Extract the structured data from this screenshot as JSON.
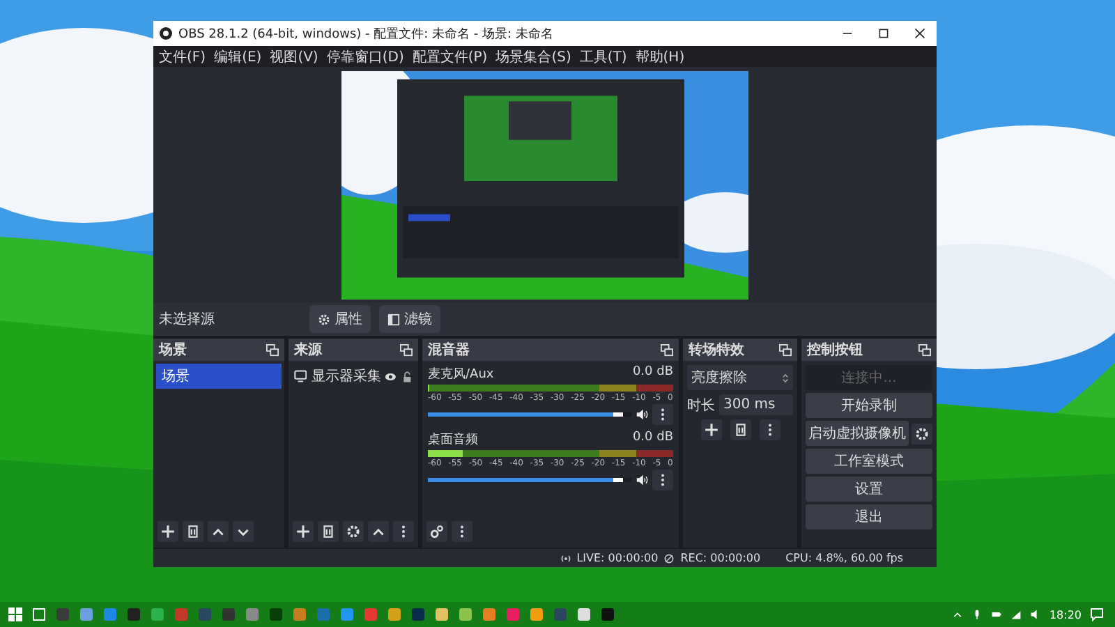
{
  "window": {
    "title": "OBS 28.1.2 (64-bit, windows) - 配置文件: 未命名 - 场景: 未命名"
  },
  "menu": [
    "文件(F)",
    "编辑(E)",
    "视图(V)",
    "停靠窗口(D)",
    "配置文件(P)",
    "场景集合(S)",
    "工具(T)",
    "帮助(H)"
  ],
  "context_bar": {
    "label": "未选择源",
    "buttons": [
      {
        "label": "属性",
        "kind": "gear"
      },
      {
        "label": "滤镜",
        "kind": "filter"
      }
    ]
  },
  "scenes": {
    "title": "场景",
    "items": [
      {
        "label": "场景",
        "selected": true
      }
    ]
  },
  "sources": {
    "title": "来源",
    "items": [
      {
        "label": "显示器采集",
        "visible": true,
        "locked": false
      }
    ]
  },
  "mixer": {
    "title": "混音器",
    "channels": [
      {
        "name": "麦克风/Aux",
        "reading": "0.0 dB",
        "meter": {
          "level": 0
        },
        "ticks": [
          "-60",
          "-55",
          "-50",
          "-45",
          "-40",
          "-35",
          "-30",
          "-25",
          "-20",
          "-15",
          "-10",
          "-5",
          "0"
        ],
        "volume": {
          "level": 0.96
        },
        "muted": false
      },
      {
        "name": "桌面音频",
        "reading": "0.0 dB",
        "meter": {
          "level": 0.14
        },
        "ticks": [
          "-60",
          "-55",
          "-50",
          "-45",
          "-40",
          "-35",
          "-30",
          "-25",
          "-20",
          "-15",
          "-10",
          "-5",
          "0"
        ],
        "volume": {
          "level": 0.96
        },
        "muted": false
      }
    ]
  },
  "transitions": {
    "title": "转场特效",
    "selected": "亮度擦除",
    "duration_label": "时长",
    "duration": "300 ms"
  },
  "controls": {
    "title": "控制按钮",
    "buttons": [
      {
        "label": "连接中...",
        "disabled": true,
        "gear": false
      },
      {
        "label": "开始录制",
        "disabled": false,
        "gear": false
      },
      {
        "label": "启动虚拟摄像机",
        "disabled": false,
        "gear": true
      },
      {
        "label": "工作室模式",
        "disabled": false,
        "gear": false
      },
      {
        "label": "设置",
        "disabled": false,
        "gear": false
      },
      {
        "label": "退出",
        "disabled": false,
        "gear": false
      }
    ]
  },
  "status_bar": {
    "live": "LIVE: 00:00:00",
    "rec": "REC: 00:00:00",
    "cpu": "CPU: 4.8%, 60.00 fps"
  },
  "taskbar": {
    "time": "18:20"
  }
}
